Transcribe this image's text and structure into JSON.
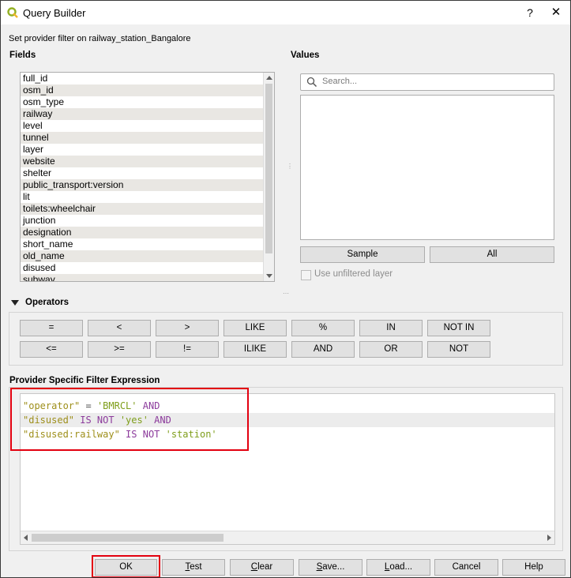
{
  "window": {
    "title": "Query Builder",
    "help_glyph": "?",
    "close_glyph": "✕"
  },
  "provider_line": "Set provider filter on railway_station_Bangalore",
  "fields": {
    "label": "Fields",
    "items": [
      "full_id",
      "osm_id",
      "osm_type",
      "railway",
      "level",
      "tunnel",
      "layer",
      "website",
      "shelter",
      "public_transport:version",
      "lit",
      "toilets:wheelchair",
      "junction",
      "designation",
      "short_name",
      "old_name",
      "disused",
      "subway"
    ]
  },
  "values": {
    "label": "Values",
    "search_placeholder": "Search...",
    "sample_label": "Sample",
    "all_label": "All",
    "unfiltered_label": "Use unfiltered layer"
  },
  "operators": {
    "label": "Operators",
    "row1": [
      "=",
      "<",
      ">",
      "LIKE",
      "%",
      "IN",
      "NOT IN"
    ],
    "row2": [
      "<=",
      ">=",
      "!=",
      "ILIKE",
      "AND",
      "OR",
      "NOT"
    ]
  },
  "expression": {
    "label": "Provider Specific Filter Expression",
    "lines": [
      [
        {
          "t": "\"operator\"",
          "k": "field"
        },
        {
          "t": " = ",
          "k": "op"
        },
        {
          "t": "'BMRCL'",
          "k": "str"
        },
        {
          "t": " AND",
          "k": "kw"
        }
      ],
      [
        {
          "t": "\"disused\"",
          "k": "field"
        },
        {
          "t": " IS NOT ",
          "k": "kw"
        },
        {
          "t": "'yes'",
          "k": "str"
        },
        {
          "t": " AND",
          "k": "kw"
        }
      ],
      [
        {
          "t": "\"disused:railway\"",
          "k": "field"
        },
        {
          "t": " IS NOT ",
          "k": "kw"
        },
        {
          "t": "'station'",
          "k": "str"
        }
      ]
    ]
  },
  "buttons": {
    "ok": "OK",
    "test_first": "T",
    "test_rest": "est",
    "clear_first": "C",
    "clear_rest": "lear",
    "save_first": "S",
    "save_rest": "ave...",
    "load_first": "L",
    "load_rest": "oad...",
    "cancel": "Cancel",
    "help": "Help"
  },
  "colors": {
    "highlight_box": "#e3000f",
    "field_token": "#9e8f1b",
    "keyword_token": "#8c3b9c",
    "string_token": "#7f9e1b"
  }
}
